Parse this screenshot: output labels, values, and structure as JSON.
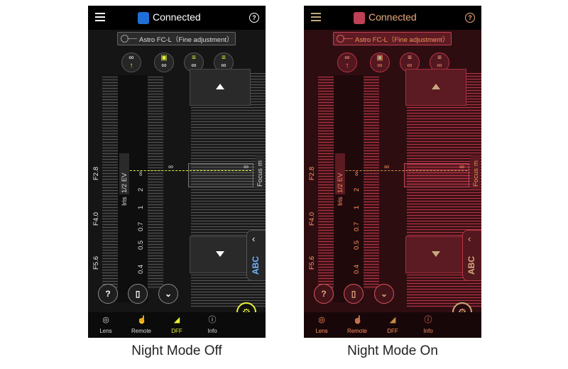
{
  "panels": [
    {
      "mode": "off",
      "connection": "Connected",
      "lens": "Astro FC-L（Fine adjustment）"
    },
    {
      "mode": "on",
      "connection": "Connected",
      "lens": "Astro FC-L（Fine adjustment）"
    }
  ],
  "scale": {
    "iris_title": "Iris",
    "iris_step": "1/2 EV",
    "fstops": [
      "F2.8",
      "F4.0",
      "F5.6"
    ],
    "distances": [
      "∞",
      "2",
      "1",
      "0.7",
      "0.5",
      "0.4"
    ],
    "focus_title": "Focus",
    "focus_unit": "m",
    "inf": "∞"
  },
  "controls": {
    "help": "?",
    "abc": "ABC"
  },
  "nav": [
    {
      "label": "Lens",
      "icon": "aperture-icon"
    },
    {
      "label": "Remote",
      "icon": "hand-icon"
    },
    {
      "label": "DFF",
      "icon": "dff-icon"
    },
    {
      "label": "Info",
      "icon": "info-icon"
    }
  ],
  "captions": [
    "Night Mode Off",
    "Night Mode On"
  ],
  "colors": {
    "accent": "#e7f23a",
    "night": "#d01818",
    "bluetooth": "#1f6fd6"
  }
}
